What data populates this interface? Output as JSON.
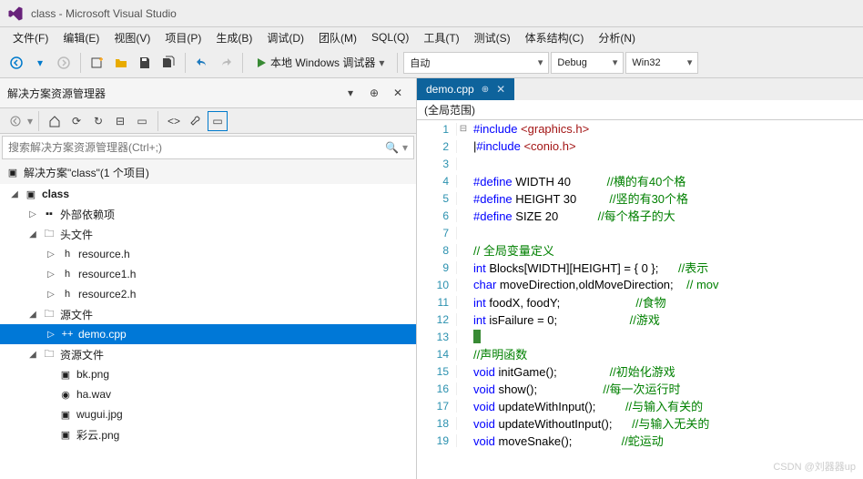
{
  "window": {
    "title": "class - Microsoft Visual Studio"
  },
  "menu": {
    "items": [
      "文件(F)",
      "编辑(E)",
      "视图(V)",
      "项目(P)",
      "生成(B)",
      "调试(D)",
      "团队(M)",
      "SQL(Q)",
      "工具(T)",
      "测试(S)",
      "体系结构(C)",
      "分析(N)"
    ]
  },
  "toolbar": {
    "debug_target": "本地 Windows 调试器",
    "auto": "自动",
    "config": "Debug",
    "platform": "Win32"
  },
  "explorer": {
    "title": "解决方案资源管理器",
    "search_placeholder": "搜索解决方案资源管理器(Ctrl+;)",
    "solution": "解决方案\"class\"(1 个项目)",
    "project": "class",
    "nodes": {
      "ext": "外部依赖项",
      "headers": "头文件",
      "h1": "resource.h",
      "h2": "resource1.h",
      "h3": "resource2.h",
      "src": "源文件",
      "demo": "demo.cpp",
      "res": "资源文件",
      "r1": "bk.png",
      "r2": "ha.wav",
      "r3": "wugui.jpg",
      "r4": "彩云.png"
    }
  },
  "editor": {
    "tab": "demo.cpp",
    "scope": "(全局范围)"
  },
  "code_lines": [
    {
      "n": 1,
      "fold": "⊟",
      "segs": [
        {
          "c": "k-blue",
          "t": "#include "
        },
        {
          "c": "k-red",
          "t": "<graphics.h>"
        }
      ]
    },
    {
      "n": 2,
      "fold": "",
      "segs": [
        {
          "c": "k-black",
          "t": "|"
        },
        {
          "c": "k-blue",
          "t": "#include "
        },
        {
          "c": "k-red",
          "t": "<conio.h>"
        }
      ]
    },
    {
      "n": 3,
      "fold": "",
      "segs": []
    },
    {
      "n": 4,
      "fold": "",
      "segs": [
        {
          "c": "k-blue",
          "t": "#define"
        },
        {
          "c": "k-black",
          "t": " WIDTH 40           "
        },
        {
          "c": "k-green",
          "t": "//横的有40个格"
        }
      ]
    },
    {
      "n": 5,
      "fold": "",
      "segs": [
        {
          "c": "k-blue",
          "t": "#define"
        },
        {
          "c": "k-black",
          "t": " HEIGHT 30          "
        },
        {
          "c": "k-green",
          "t": "//竖的有30个格"
        }
      ]
    },
    {
      "n": 6,
      "fold": "",
      "segs": [
        {
          "c": "k-blue",
          "t": "#define"
        },
        {
          "c": "k-black",
          "t": " SIZE 20            "
        },
        {
          "c": "k-green",
          "t": "//每个格子的大"
        }
      ]
    },
    {
      "n": 7,
      "fold": "",
      "segs": []
    },
    {
      "n": 8,
      "fold": "",
      "segs": [
        {
          "c": "k-green",
          "t": "// 全局变量定义"
        }
      ]
    },
    {
      "n": 9,
      "fold": "",
      "segs": [
        {
          "c": "k-blue",
          "t": "int"
        },
        {
          "c": "k-black",
          "t": " Blocks[WIDTH][HEIGHT] = { 0 };      "
        },
        {
          "c": "k-green",
          "t": "//表示"
        }
      ]
    },
    {
      "n": 10,
      "fold": "",
      "segs": [
        {
          "c": "k-blue",
          "t": "char"
        },
        {
          "c": "k-black",
          "t": " moveDirection,oldMoveDirection;    "
        },
        {
          "c": "k-green",
          "t": "// mov"
        }
      ]
    },
    {
      "n": 11,
      "fold": "",
      "segs": [
        {
          "c": "k-blue",
          "t": "int"
        },
        {
          "c": "k-black",
          "t": " foodX, foodY;                       "
        },
        {
          "c": "k-green",
          "t": "//食物"
        }
      ]
    },
    {
      "n": 12,
      "fold": "",
      "segs": [
        {
          "c": "k-blue",
          "t": "int"
        },
        {
          "c": "k-black",
          "t": " isFailure = 0;                      "
        },
        {
          "c": "k-green",
          "t": "//游戏"
        }
      ]
    },
    {
      "n": 13,
      "fold": "",
      "segs": [],
      "mark": true
    },
    {
      "n": 14,
      "fold": "",
      "segs": [
        {
          "c": "k-green",
          "t": "//声明函数"
        }
      ]
    },
    {
      "n": 15,
      "fold": "",
      "segs": [
        {
          "c": "k-blue",
          "t": "void"
        },
        {
          "c": "k-black",
          "t": " initGame();                "
        },
        {
          "c": "k-green",
          "t": "//初始化游戏"
        }
      ]
    },
    {
      "n": 16,
      "fold": "",
      "segs": [
        {
          "c": "k-blue",
          "t": "void"
        },
        {
          "c": "k-black",
          "t": " show();                    "
        },
        {
          "c": "k-green",
          "t": "//每一次运行时"
        }
      ]
    },
    {
      "n": 17,
      "fold": "",
      "segs": [
        {
          "c": "k-blue",
          "t": "void"
        },
        {
          "c": "k-black",
          "t": " updateWithInput();         "
        },
        {
          "c": "k-green",
          "t": "//与输入有关的"
        }
      ]
    },
    {
      "n": 18,
      "fold": "",
      "segs": [
        {
          "c": "k-blue",
          "t": "void"
        },
        {
          "c": "k-black",
          "t": " updateWithoutInput();      "
        },
        {
          "c": "k-green",
          "t": "//与输入无关的"
        }
      ]
    },
    {
      "n": 19,
      "fold": "",
      "segs": [
        {
          "c": "k-blue",
          "t": "void"
        },
        {
          "c": "k-black",
          "t": " moveSnake();               "
        },
        {
          "c": "k-green",
          "t": "//蛇运动"
        }
      ]
    }
  ],
  "watermark": "CSDN @刘器器up"
}
